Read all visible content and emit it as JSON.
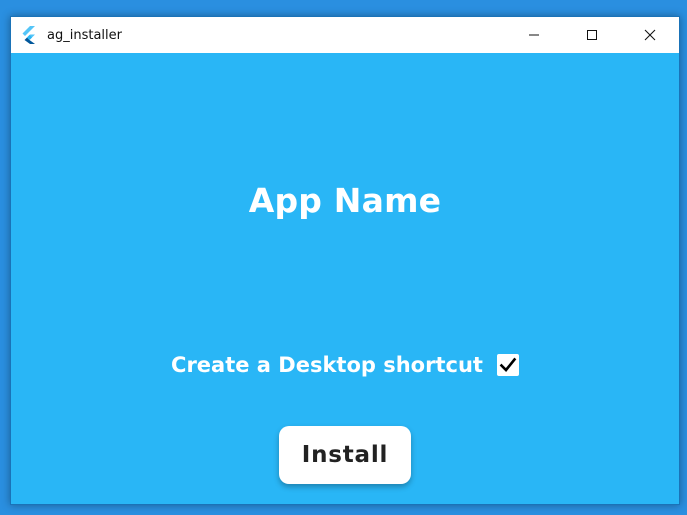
{
  "window": {
    "title": "ag_installer",
    "icon": "flutter-logo-icon",
    "controls": [
      "minimize-icon",
      "maximize-icon",
      "close-icon"
    ]
  },
  "main": {
    "app_name": "App Name",
    "shortcut_label": "Create a Desktop shortcut",
    "shortcut_checked": true,
    "install_label": "Install"
  },
  "colors": {
    "background": "#29b6f6",
    "titlebar": "#ffffff",
    "text": "#ffffff",
    "button_text": "#222222"
  }
}
